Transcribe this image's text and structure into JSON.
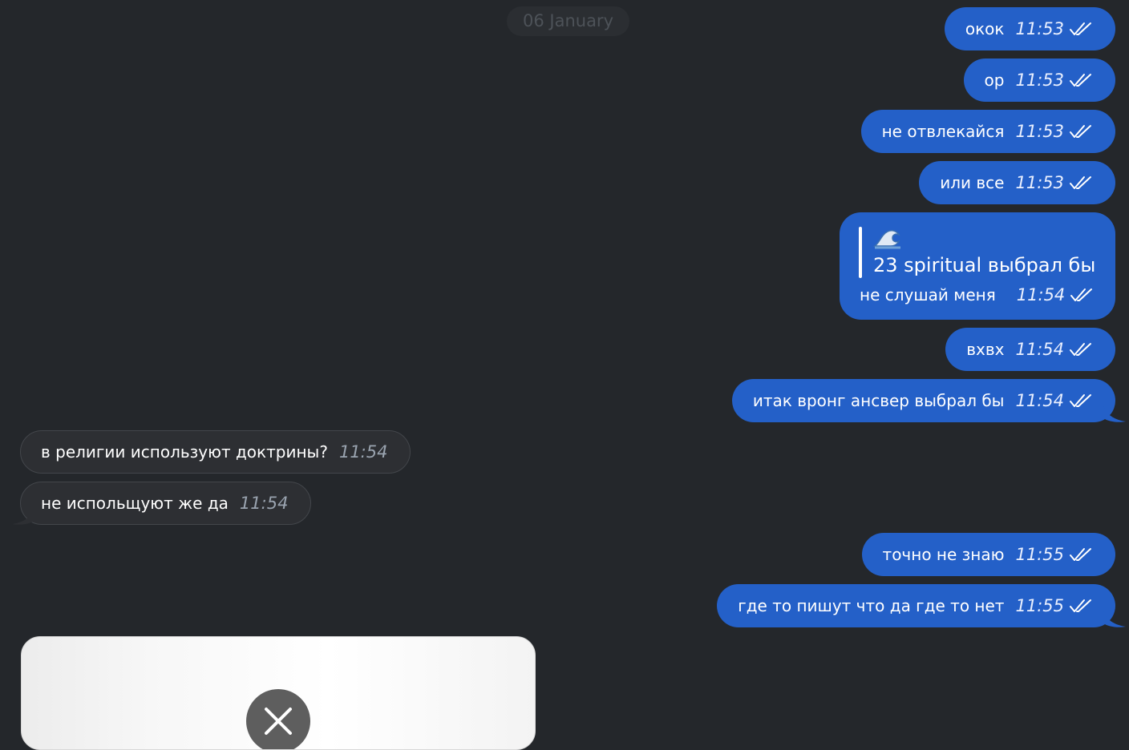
{
  "date_separator": "06 January",
  "outgoing_messages": [
    {
      "text": "окок",
      "time": "11:53",
      "status": "read"
    },
    {
      "text": "ор",
      "time": "11:53",
      "status": "read"
    },
    {
      "text": "не отвлекайся",
      "time": "11:53",
      "status": "read"
    },
    {
      "text": "или все",
      "time": "11:53",
      "status": "read"
    },
    {
      "text": "вхвх",
      "time": "11:54",
      "status": "read"
    },
    {
      "text": "итак вронг ансвер выбрал бы",
      "time": "11:54",
      "status": "read"
    },
    {
      "text": "точно не знаю",
      "time": "11:55",
      "status": "read"
    },
    {
      "text": "где то пишут что да где то нет",
      "time": "11:55",
      "status": "read"
    }
  ],
  "reply_message": {
    "quote_icon": "wave-emoji-icon",
    "quote_text": "23 spiritual выбрал бы",
    "text": "не слушай меня",
    "time": "11:54",
    "status": "read"
  },
  "incoming_messages": [
    {
      "text": "в религии используют доктрины?",
      "time": "11:54"
    },
    {
      "text": "не испольщуют же да",
      "time": "11:54"
    }
  ],
  "media_message": {
    "close_icon": "close-icon"
  },
  "colors": {
    "background": "#24272b",
    "outgoing_bubble": "#2460c8",
    "incoming_bubble": "#2d2f33"
  }
}
